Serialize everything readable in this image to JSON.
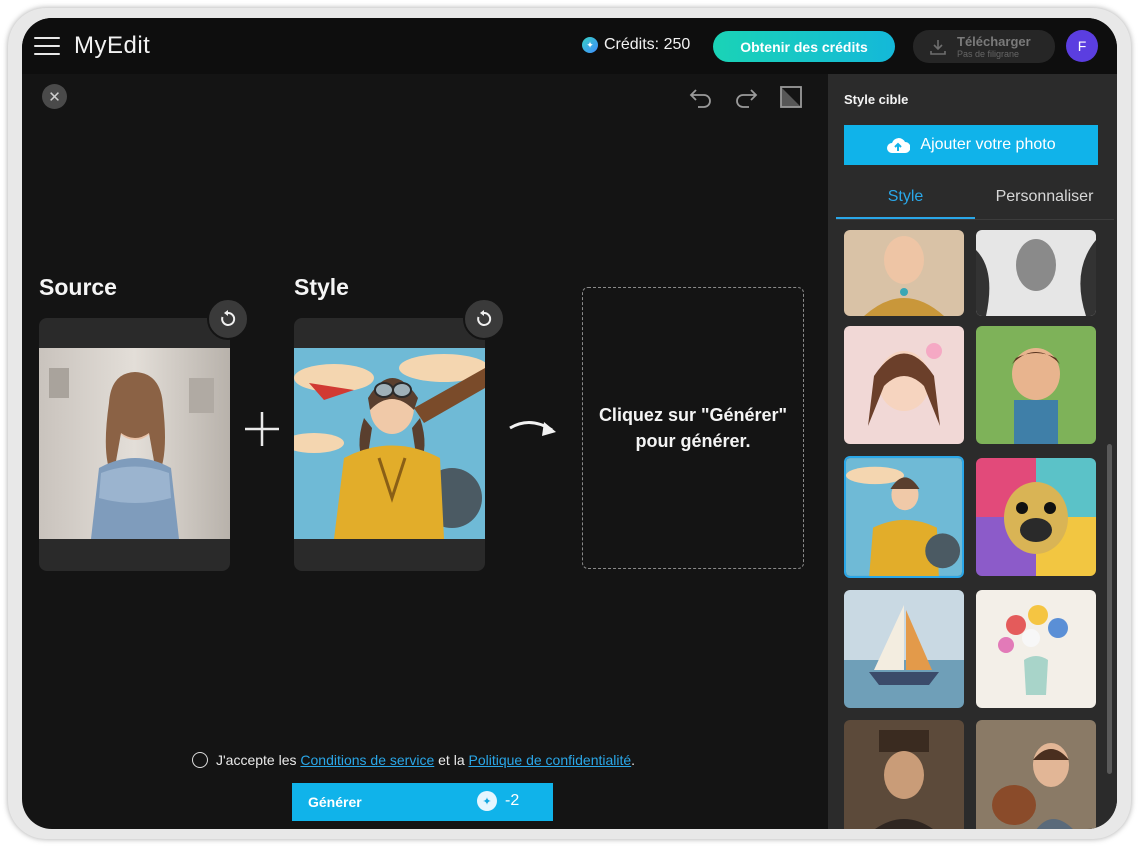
{
  "app": {
    "name": "MyEdit"
  },
  "header": {
    "credits_label": "Crédits: 250",
    "get_credits_label": "Obtenir des crédits",
    "download_label": "Télécharger",
    "download_sub": "Pas de filigrane",
    "avatar_initial": "F"
  },
  "editor": {
    "source_label": "Source",
    "style_label": "Style",
    "result_text": "Cliquez sur \"Générer\" pour générer."
  },
  "footer": {
    "terms_prefix": "J'accepte les",
    "terms_link": "Conditions de service",
    "terms_mid": "et la",
    "privacy_link": "Politique de confidentialité",
    "terms_end": ".",
    "generate_label": "Générer",
    "generate_cost": "-2"
  },
  "panel": {
    "title": "Style cible",
    "add_photo_label": "Ajouter votre photo",
    "tabs": [
      "Style",
      "Personnaliser"
    ],
    "active_tab": "Style",
    "thumbnails": [
      "jewelry portrait",
      "ink sketch portrait",
      "anime girl",
      "3d cartoon boy",
      "pin-up aviator",
      "pop art pug",
      "sailboat painting",
      "flower vase watercolor",
      "steampunk man",
      "boy with dog"
    ],
    "selected_thumbnail": "pin-up aviator"
  },
  "colors": {
    "accent": "#10b3ea",
    "accent_link": "#2aa7e8",
    "avatar": "#5b3ee0"
  }
}
